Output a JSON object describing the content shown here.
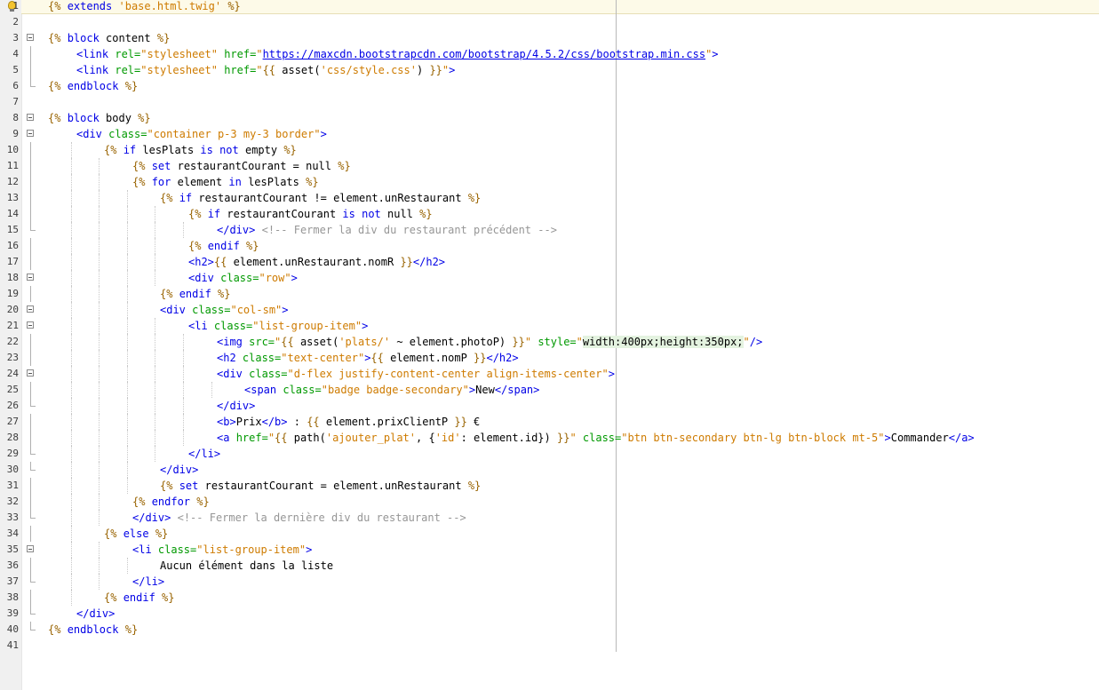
{
  "editor": {
    "hint_icon": "lightbulb-icon",
    "accent_colors": {
      "twig_delimiter": "#996300",
      "keyword": "#0000e6",
      "html_tag": "#0000e6",
      "attribute": "#009900",
      "string": "#ce7b00",
      "comment": "#969696"
    },
    "lines": [
      {
        "no": "1",
        "fold": "none",
        "indent": 0,
        "tokens": [
          [
            "d",
            "{% "
          ],
          [
            "k",
            "extends"
          ],
          [
            "p",
            " "
          ],
          [
            "s",
            "'base.html.twig'"
          ],
          [
            "d",
            " %}"
          ]
        ]
      },
      {
        "no": "2",
        "fold": "none",
        "indent": 0,
        "tokens": []
      },
      {
        "no": "3",
        "fold": "open",
        "indent": 0,
        "tokens": [
          [
            "d",
            "{% "
          ],
          [
            "k",
            "block"
          ],
          [
            "p",
            " content "
          ],
          [
            "d",
            "%}"
          ]
        ]
      },
      {
        "no": "4",
        "fold": "bar",
        "indent": 1,
        "tokens": [
          [
            "t",
            "<link "
          ],
          [
            "a",
            "rel="
          ],
          [
            "s",
            "\"stylesheet\""
          ],
          [
            "p",
            " "
          ],
          [
            "a",
            "href="
          ],
          [
            "s",
            "\""
          ],
          [
            "u",
            "https://maxcdn.bootstrapcdn.com/bootstrap/4.5.2/css/bootstrap.min.css"
          ],
          [
            "s",
            "\""
          ],
          [
            "t",
            ">"
          ]
        ]
      },
      {
        "no": "5",
        "fold": "bar",
        "indent": 1,
        "tokens": [
          [
            "t",
            "<link "
          ],
          [
            "a",
            "rel="
          ],
          [
            "s",
            "\"stylesheet\""
          ],
          [
            "p",
            " "
          ],
          [
            "a",
            "href="
          ],
          [
            "s",
            "\""
          ],
          [
            "d",
            "{{ "
          ],
          [
            "p",
            "asset("
          ],
          [
            "s",
            "'css/style.css'"
          ],
          [
            "p",
            ") "
          ],
          [
            "d",
            "}}"
          ],
          [
            "s",
            "\""
          ],
          [
            "t",
            ">"
          ]
        ]
      },
      {
        "no": "6",
        "fold": "end",
        "indent": 0,
        "tokens": [
          [
            "d",
            "{% "
          ],
          [
            "k",
            "endblock"
          ],
          [
            "p",
            " "
          ],
          [
            "d",
            "%}"
          ]
        ]
      },
      {
        "no": "7",
        "fold": "none",
        "indent": 0,
        "tokens": []
      },
      {
        "no": "8",
        "fold": "open",
        "indent": 0,
        "tokens": [
          [
            "d",
            "{% "
          ],
          [
            "k",
            "block"
          ],
          [
            "p",
            " body "
          ],
          [
            "d",
            "%}"
          ]
        ]
      },
      {
        "no": "9",
        "fold": "open",
        "indent": 1,
        "tokens": [
          [
            "t",
            "<div "
          ],
          [
            "a",
            "class="
          ],
          [
            "s",
            "\"container p-3 my-3 border\""
          ],
          [
            "t",
            ">"
          ]
        ]
      },
      {
        "no": "10",
        "fold": "bar",
        "indent": 2,
        "tokens": [
          [
            "d",
            "{% "
          ],
          [
            "k",
            "if"
          ],
          [
            "p",
            " lesPlats "
          ],
          [
            "k",
            "is not"
          ],
          [
            "p",
            " empty "
          ],
          [
            "d",
            "%}"
          ]
        ]
      },
      {
        "no": "11",
        "fold": "bar",
        "indent": 3,
        "tokens": [
          [
            "d",
            "{% "
          ],
          [
            "k",
            "set"
          ],
          [
            "p",
            " restaurantCourant = null "
          ],
          [
            "d",
            "%}"
          ]
        ]
      },
      {
        "no": "12",
        "fold": "bar",
        "indent": 3,
        "tokens": [
          [
            "d",
            "{% "
          ],
          [
            "k",
            "for"
          ],
          [
            "p",
            " element "
          ],
          [
            "k",
            "in"
          ],
          [
            "p",
            " lesPlats "
          ],
          [
            "d",
            "%}"
          ]
        ]
      },
      {
        "no": "13",
        "fold": "bar",
        "indent": 4,
        "tokens": [
          [
            "d",
            "{% "
          ],
          [
            "k",
            "if"
          ],
          [
            "p",
            " restaurantCourant != element.unRestaurant "
          ],
          [
            "d",
            "%}"
          ]
        ]
      },
      {
        "no": "14",
        "fold": "bar",
        "indent": 5,
        "tokens": [
          [
            "d",
            "{% "
          ],
          [
            "k",
            "if"
          ],
          [
            "p",
            " restaurantCourant "
          ],
          [
            "k",
            "is not"
          ],
          [
            "p",
            " null "
          ],
          [
            "d",
            "%}"
          ]
        ]
      },
      {
        "no": "15",
        "fold": "end",
        "indent": 6,
        "tokens": [
          [
            "t",
            "</div>"
          ],
          [
            "p",
            " "
          ],
          [
            "c",
            "<!-- Fermer la div du restaurant précédent -->"
          ]
        ]
      },
      {
        "no": "16",
        "fold": "bar",
        "indent": 5,
        "tokens": [
          [
            "d",
            "{% "
          ],
          [
            "k",
            "endif"
          ],
          [
            "p",
            " "
          ],
          [
            "d",
            "%}"
          ]
        ]
      },
      {
        "no": "17",
        "fold": "bar",
        "indent": 5,
        "tokens": [
          [
            "t",
            "<h2>"
          ],
          [
            "d",
            "{{ "
          ],
          [
            "p",
            "element.unRestaurant.nomR "
          ],
          [
            "d",
            "}}"
          ],
          [
            "t",
            "</h2>"
          ]
        ]
      },
      {
        "no": "18",
        "fold": "open",
        "indent": 5,
        "tokens": [
          [
            "t",
            "<div "
          ],
          [
            "a",
            "class="
          ],
          [
            "s",
            "\"row\""
          ],
          [
            "t",
            ">"
          ]
        ]
      },
      {
        "no": "19",
        "fold": "bar",
        "indent": 4,
        "tokens": [
          [
            "d",
            "{% "
          ],
          [
            "k",
            "endif"
          ],
          [
            "p",
            " "
          ],
          [
            "d",
            "%}"
          ]
        ]
      },
      {
        "no": "20",
        "fold": "open",
        "indent": 4,
        "tokens": [
          [
            "t",
            "<div "
          ],
          [
            "a",
            "class="
          ],
          [
            "s",
            "\"col-sm\""
          ],
          [
            "t",
            ">"
          ]
        ]
      },
      {
        "no": "21",
        "fold": "open",
        "indent": 5,
        "tokens": [
          [
            "t",
            "<li "
          ],
          [
            "a",
            "class="
          ],
          [
            "s",
            "\"list-group-item\""
          ],
          [
            "t",
            ">"
          ]
        ]
      },
      {
        "no": "22",
        "fold": "bar",
        "indent": 6,
        "tokens": [
          [
            "t",
            "<img "
          ],
          [
            "a",
            "src="
          ],
          [
            "s",
            "\""
          ],
          [
            "d",
            "{{ "
          ],
          [
            "p",
            "asset("
          ],
          [
            "s",
            "'plats/'"
          ],
          [
            "p",
            " ~ element.photoP) "
          ],
          [
            "d",
            "}}"
          ],
          [
            "s",
            "\""
          ],
          [
            "p",
            " "
          ],
          [
            "a",
            "style="
          ],
          [
            "s",
            "\""
          ],
          [
            "h",
            "width:400px;height:350px;"
          ],
          [
            "s",
            "\""
          ],
          [
            "t",
            "/>"
          ]
        ]
      },
      {
        "no": "23",
        "fold": "bar",
        "indent": 6,
        "tokens": [
          [
            "t",
            "<h2 "
          ],
          [
            "a",
            "class="
          ],
          [
            "s",
            "\"text-center\""
          ],
          [
            "t",
            ">"
          ],
          [
            "d",
            "{{ "
          ],
          [
            "p",
            "element.nomP "
          ],
          [
            "d",
            "}}"
          ],
          [
            "t",
            "</h2>"
          ]
        ]
      },
      {
        "no": "24",
        "fold": "open",
        "indent": 6,
        "tokens": [
          [
            "t",
            "<div "
          ],
          [
            "a",
            "class="
          ],
          [
            "s",
            "\"d-flex justify-content-center align-items-center\""
          ],
          [
            "t",
            ">"
          ]
        ]
      },
      {
        "no": "25",
        "fold": "bar",
        "indent": 7,
        "tokens": [
          [
            "t",
            "<span "
          ],
          [
            "a",
            "class="
          ],
          [
            "s",
            "\"badge badge-secondary\""
          ],
          [
            "t",
            ">"
          ],
          [
            "p",
            "New"
          ],
          [
            "t",
            "</span>"
          ]
        ]
      },
      {
        "no": "26",
        "fold": "end",
        "indent": 6,
        "tokens": [
          [
            "t",
            "</div>"
          ]
        ]
      },
      {
        "no": "27",
        "fold": "bar",
        "indent": 6,
        "tokens": [
          [
            "t",
            "<b>"
          ],
          [
            "p",
            "Prix"
          ],
          [
            "t",
            "</b>"
          ],
          [
            "p",
            " : "
          ],
          [
            "d",
            "{{ "
          ],
          [
            "p",
            "element.prixClientP "
          ],
          [
            "d",
            "}}"
          ],
          [
            "p",
            " €"
          ]
        ]
      },
      {
        "no": "28",
        "fold": "bar",
        "indent": 6,
        "tokens": [
          [
            "t",
            "<a "
          ],
          [
            "a",
            "href="
          ],
          [
            "s",
            "\""
          ],
          [
            "d",
            "{{ "
          ],
          [
            "p",
            "path("
          ],
          [
            "s",
            "'ajouter_plat'"
          ],
          [
            "p",
            ", {"
          ],
          [
            "s",
            "'id'"
          ],
          [
            "p",
            ": element.id}) "
          ],
          [
            "d",
            "}}"
          ],
          [
            "s",
            "\""
          ],
          [
            "p",
            " "
          ],
          [
            "a",
            "class="
          ],
          [
            "s",
            "\"btn btn-secondary btn-lg btn-block mt-5\""
          ],
          [
            "t",
            ">"
          ],
          [
            "p",
            "Commander"
          ],
          [
            "t",
            "</a>"
          ]
        ]
      },
      {
        "no": "29",
        "fold": "end",
        "indent": 5,
        "tokens": [
          [
            "t",
            "</li>"
          ]
        ]
      },
      {
        "no": "30",
        "fold": "end",
        "indent": 4,
        "tokens": [
          [
            "t",
            "</div>"
          ]
        ]
      },
      {
        "no": "31",
        "fold": "bar",
        "indent": 4,
        "tokens": [
          [
            "d",
            "{% "
          ],
          [
            "k",
            "set"
          ],
          [
            "p",
            " restaurantCourant = element.unRestaurant "
          ],
          [
            "d",
            "%}"
          ]
        ]
      },
      {
        "no": "32",
        "fold": "bar",
        "indent": 3,
        "tokens": [
          [
            "d",
            "{% "
          ],
          [
            "k",
            "endfor"
          ],
          [
            "p",
            " "
          ],
          [
            "d",
            "%}"
          ]
        ]
      },
      {
        "no": "33",
        "fold": "end",
        "indent": 3,
        "tokens": [
          [
            "t",
            "</div>"
          ],
          [
            "p",
            " "
          ],
          [
            "c",
            "<!-- Fermer la dernière div du restaurant -->"
          ]
        ]
      },
      {
        "no": "34",
        "fold": "bar",
        "indent": 2,
        "tokens": [
          [
            "d",
            "{% "
          ],
          [
            "k",
            "else"
          ],
          [
            "p",
            " "
          ],
          [
            "d",
            "%}"
          ]
        ]
      },
      {
        "no": "35",
        "fold": "open",
        "indent": 3,
        "tokens": [
          [
            "t",
            "<li "
          ],
          [
            "a",
            "class="
          ],
          [
            "s",
            "\"list-group-item\""
          ],
          [
            "t",
            ">"
          ]
        ]
      },
      {
        "no": "36",
        "fold": "bar",
        "indent": 4,
        "tokens": [
          [
            "p",
            "Aucun élément dans la liste"
          ]
        ]
      },
      {
        "no": "37",
        "fold": "end",
        "indent": 3,
        "tokens": [
          [
            "t",
            "</li>"
          ]
        ]
      },
      {
        "no": "38",
        "fold": "bar",
        "indent": 2,
        "tokens": [
          [
            "d",
            "{% "
          ],
          [
            "k",
            "endif"
          ],
          [
            "p",
            " "
          ],
          [
            "d",
            "%}"
          ]
        ]
      },
      {
        "no": "39",
        "fold": "end",
        "indent": 1,
        "tokens": [
          [
            "t",
            "</div>"
          ]
        ]
      },
      {
        "no": "40",
        "fold": "end",
        "indent": 0,
        "tokens": [
          [
            "d",
            "{% "
          ],
          [
            "k",
            "endblock"
          ],
          [
            "p",
            " "
          ],
          [
            "d",
            "%}"
          ]
        ]
      },
      {
        "no": "41",
        "fold": "none",
        "indent": 0,
        "tokens": []
      }
    ]
  }
}
